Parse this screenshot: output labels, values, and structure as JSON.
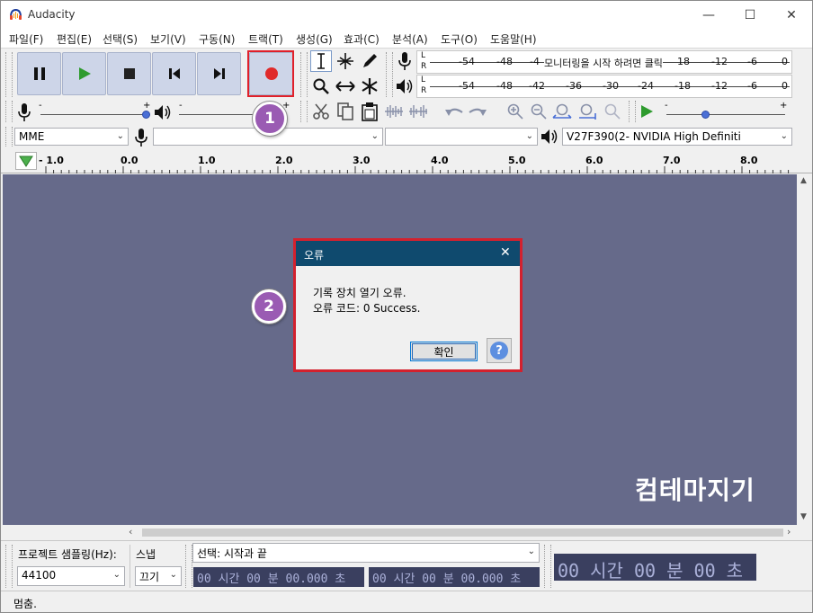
{
  "window": {
    "title": "Audacity",
    "minimize": "—",
    "maximize": "☐",
    "close": "✕"
  },
  "menu": [
    "파일(F)",
    "편집(E)",
    "선택(S)",
    "보기(V)",
    "구동(N)",
    "트랙(T)",
    "생성(G)",
    "효과(C)",
    "분석(A)",
    "도구(O)",
    "도움말(H)"
  ],
  "meters": {
    "record": {
      "l": "L",
      "r": "R",
      "ticks": [
        "-54",
        "-48",
        "-4"
      ],
      "hint": "모니터링을 시작 하려면 클릭",
      "ticks_right": [
        "18",
        "-12",
        "-6",
        "0"
      ]
    },
    "playback": {
      "l": "L",
      "r": "R",
      "ticks": [
        "-54",
        "-48",
        "-42",
        "-36",
        "-30",
        "-24",
        "-18",
        "-12",
        "-6",
        "0"
      ]
    }
  },
  "sliders": {
    "record_minus": "-",
    "record_plus": "+",
    "play_minus": "-",
    "play_plus": "+",
    "speed_minus": "-",
    "speed_plus": "+"
  },
  "devices": {
    "host": "MME",
    "input": "",
    "channels": "",
    "output": "V27F390(2- NVIDIA High Definiti"
  },
  "ruler": {
    "ticks": [
      "- 1.0",
      "0.0",
      "1.0",
      "2.0",
      "3.0",
      "4.0",
      "5.0",
      "6.0",
      "7.0",
      "8.0"
    ]
  },
  "dialog": {
    "title": "오류",
    "line1": "기록 장치 열기 오류.",
    "line2": "오류 코드: 0 Success.",
    "ok": "확인",
    "help": "?"
  },
  "badges": [
    "1",
    "2"
  ],
  "bottom": {
    "rate_label": "프로젝트 샘플링(Hz):",
    "rate_value": "44100",
    "snap_label": "스냅",
    "snap_value": "끄기",
    "selection_label": "선택: 시작과 끝",
    "sel_start": "00 시간 00 분 00.000 초",
    "sel_end": "00 시간 00 분 00.000 초",
    "big_time": "00 시간 00 분 00 초"
  },
  "status": "멈춤.",
  "watermark": "컴테마지기",
  "colors": {
    "track_bg": "#666a8a",
    "dialog_title": "#0f4a6e",
    "highlight": "#e0202a",
    "badge": "#9a5bb3",
    "transport": "#cdd5e8"
  }
}
